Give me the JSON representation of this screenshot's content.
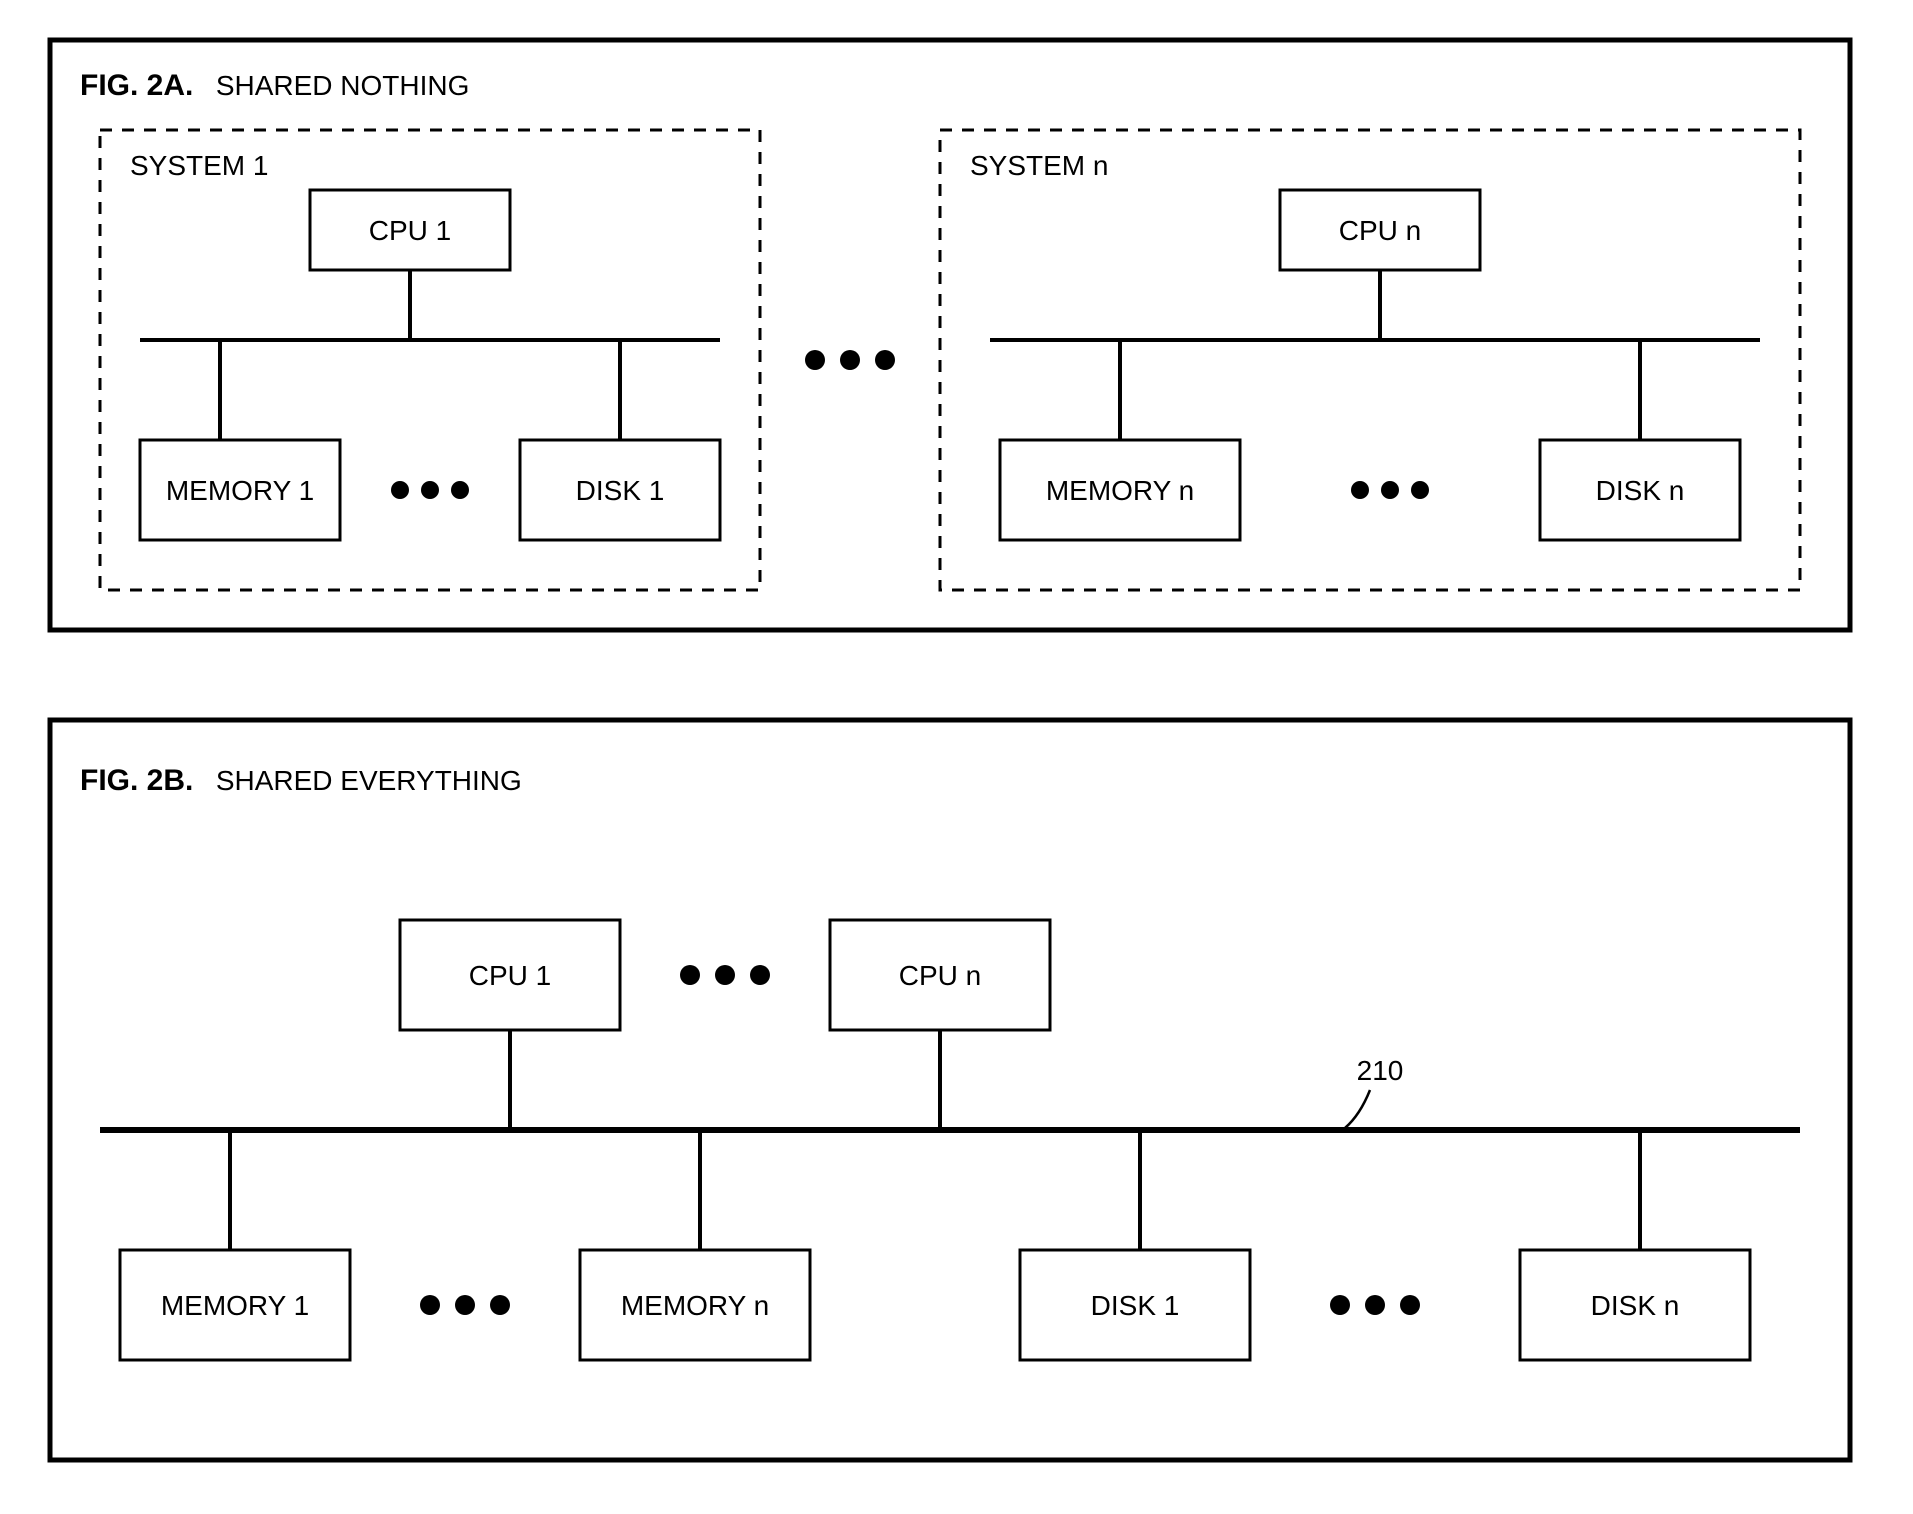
{
  "fig2a": {
    "id_bold": "FIG. 2A.",
    "title": "SHARED NOTHING",
    "system1": {
      "label": "SYSTEM 1",
      "cpu": "CPU 1",
      "memory": "MEMORY 1",
      "disk": "DISK 1"
    },
    "systemN": {
      "label": "SYSTEM n",
      "cpu": "CPU n",
      "memory": "MEMORY n",
      "disk": "DISK n"
    }
  },
  "fig2b": {
    "id_bold": "FIG. 2B.",
    "title": "SHARED EVERYTHING",
    "cpu1": "CPU 1",
    "cpuN": "CPU n",
    "mem1": "MEMORY 1",
    "memN": "MEMORY n",
    "disk1": "DISK  1",
    "diskN": "DISK n",
    "bus_ref": "210"
  }
}
